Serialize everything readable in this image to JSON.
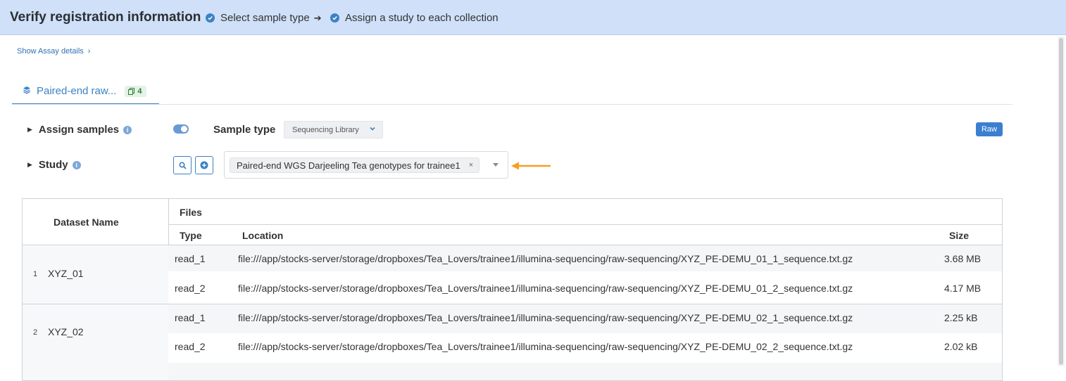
{
  "topbar": {
    "title": "Verify registration information",
    "steps": [
      {
        "label": "Select sample type"
      },
      {
        "label": "Assign a study to each collection"
      }
    ]
  },
  "assay_link": {
    "label": "Show Assay details"
  },
  "tab": {
    "label": "Paired-end raw...",
    "count": "4"
  },
  "assign": {
    "label": "Assign samples",
    "sample_type_label": "Sample type",
    "sample_type_value": "Sequencing Library",
    "toggle_on": true
  },
  "study": {
    "label": "Study",
    "selected": "Paired-end WGS Darjeeling Tea genotypes for trainee1",
    "remove": "×"
  },
  "raw_badge": "Raw",
  "table": {
    "headers": {
      "dataset_name": "Dataset Name",
      "files": "Files",
      "type": "Type",
      "location": "Location",
      "size": "Size"
    },
    "datasets": [
      {
        "index": "1",
        "name": "XYZ_01",
        "files": [
          {
            "type": "read_1",
            "location": "file:///app/stocks-server/storage/dropboxes/Tea_Lovers/trainee1/illumina-sequencing/raw-sequencing/XYZ_PE-DEMU_01_1_sequence.txt.gz",
            "size": "3.68 MB"
          },
          {
            "type": "read_2",
            "location": "file:///app/stocks-server/storage/dropboxes/Tea_Lovers/trainee1/illumina-sequencing/raw-sequencing/XYZ_PE-DEMU_01_2_sequence.txt.gz",
            "size": "4.17 MB"
          }
        ]
      },
      {
        "index": "2",
        "name": "XYZ_02",
        "files": [
          {
            "type": "read_1",
            "location": "file:///app/stocks-server/storage/dropboxes/Tea_Lovers/trainee1/illumina-sequencing/raw-sequencing/XYZ_PE-DEMU_02_1_sequence.txt.gz",
            "size": "2.25 kB"
          },
          {
            "type": "read_2",
            "location": "file:///app/stocks-server/storage/dropboxes/Tea_Lovers/trainee1/illumina-sequencing/raw-sequencing/XYZ_PE-DEMU_02_2_sequence.txt.gz",
            "size": "2.02 kB"
          }
        ]
      }
    ]
  },
  "colors": {
    "accent": "#3b82c4",
    "topbar_bg": "#cfe0f8",
    "annotation_arrow": "#f5a023",
    "count_badge_text": "#2e7d32"
  },
  "icons": [
    "check-circle-icon",
    "arrow-right-icon",
    "chevron-right-icon",
    "layers-icon",
    "copy-icon",
    "caret-right-icon",
    "info-icon",
    "chevron-down-icon",
    "search-icon",
    "plus-circle-icon",
    "close-icon",
    "dropdown-caret-icon",
    "orange-arrow-icon"
  ]
}
